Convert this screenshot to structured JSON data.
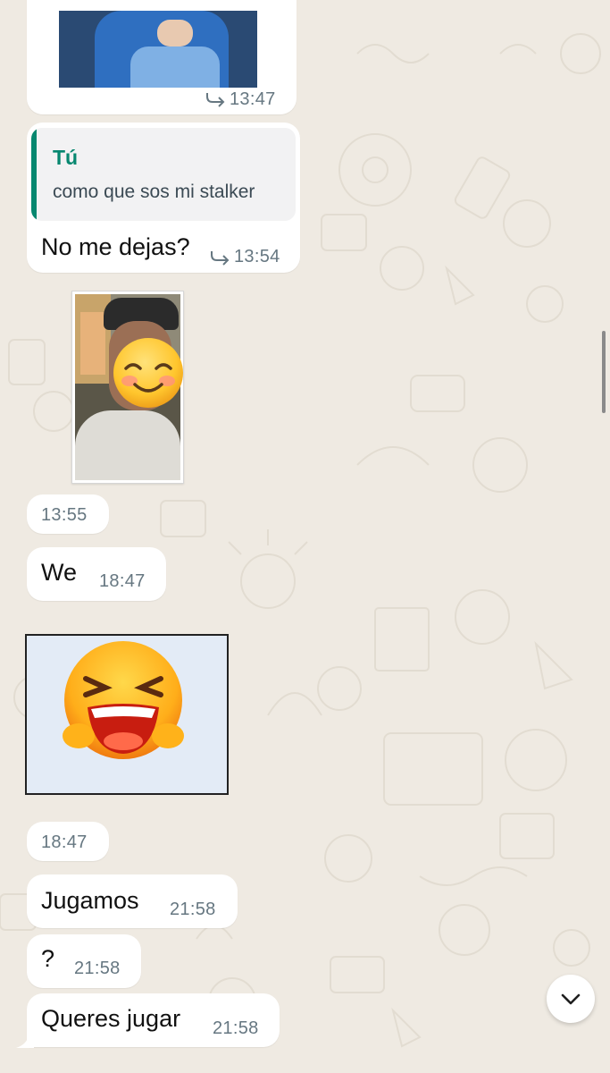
{
  "messages": {
    "top_image_time": "13:47",
    "reply": {
      "quote_author": "Tú",
      "quote_text": "como que sos mi stalker",
      "text": "No me dejas?",
      "time": "13:54"
    },
    "photo_time": "13:55",
    "we": {
      "text": "We",
      "time": "18:47"
    },
    "sticker_time": "18:47",
    "jugamos": {
      "text": "Jugamos",
      "time": "21:58"
    },
    "question": {
      "text": "?",
      "time": "21:58"
    },
    "queres": {
      "text": "Queres jugar",
      "time": "21:58"
    }
  },
  "colors": {
    "background": "#efeae2",
    "bubble": "#ffffff",
    "accent": "#06876f",
    "time_text": "#667781"
  },
  "icons": {
    "forwarded": "forward-arrow-icon",
    "scroll_down": "chevron-down-icon",
    "face_emoji": "smiling-face-emoji",
    "sticker": "laughing-face-sticker"
  }
}
